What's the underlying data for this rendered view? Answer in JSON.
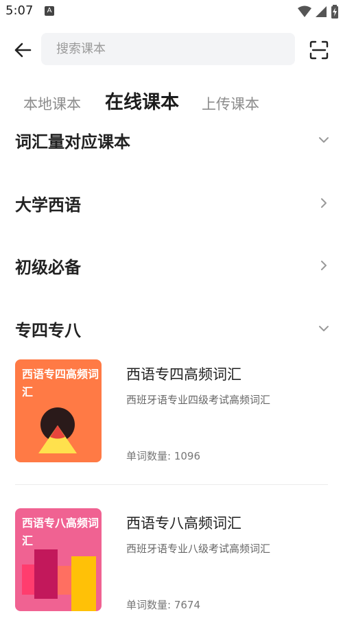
{
  "status_bar": {
    "time": "5:07",
    "app_icon": "text-a-icon",
    "icons": [
      "wifi-icon",
      "signal-icon",
      "battery-charging-icon"
    ]
  },
  "header": {
    "back_icon": "back-arrow-icon",
    "search": {
      "placeholder": "搜索课本",
      "value": ""
    },
    "scan_icon": "scan-icon"
  },
  "tabs": [
    {
      "label": "本地课本",
      "active": false
    },
    {
      "label": "在线课本",
      "active": true
    },
    {
      "label": "上传课本",
      "active": false
    }
  ],
  "sections": [
    {
      "title": "词汇量对应课本",
      "state": "expanded",
      "icon": "chevron-down-icon"
    },
    {
      "title": "大学西语",
      "state": "collapsed",
      "icon": "chevron-right-icon"
    },
    {
      "title": "初级必备",
      "state": "collapsed",
      "icon": "chevron-right-icon"
    },
    {
      "title": "专四专八",
      "state": "expanded",
      "icon": "chevron-down-icon"
    }
  ],
  "books": [
    {
      "cover_text": "西语专四高频词汇",
      "title": "西语专四高频词汇",
      "description": "西班牙语专业四级考试高频词汇",
      "count": "单词数量: 1096",
      "cover_color": "#ff7a45"
    },
    {
      "cover_text": "西语专八高频词汇",
      "title": "西语专八高频词汇",
      "description": "西班牙语专业八级考试高频词汇",
      "count": "单词数量: 7674",
      "cover_color": "#f06292"
    }
  ],
  "colors": {
    "search_bg": "#f3f4f6",
    "text_primary": "#222222",
    "text_secondary": "#666666",
    "tab_inactive": "#8c8c8c"
  }
}
